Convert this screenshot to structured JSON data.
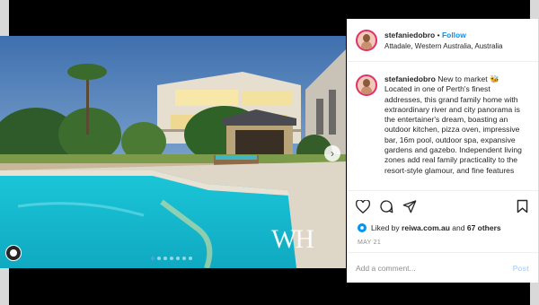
{
  "header": {
    "username": "stefaniedobro",
    "separator": "•",
    "follow_label": "Follow",
    "location": "Attadale, Western Australia, Australia"
  },
  "caption": {
    "username": "stefaniedobro",
    "text": "New to market 🐝 Located in one of Perth's finest addresses, this grand family home with extraordinary river and city panorama is the entertainer's dream, boasting an outdoor kitchen, pizza oven, impressive bar, 16m pool, outdoor spa, expansive gardens and gazebo. Independent living zones add real family practicality to the resort-style glamour, and fine features"
  },
  "actions": {
    "like_icon": "heart-icon",
    "comment_icon": "comment-icon",
    "share_icon": "share-icon",
    "save_icon": "bookmark-icon"
  },
  "likes": {
    "prefix": "Liked by",
    "user": "reiwa.com.au",
    "connector": "and",
    "others": "67 others"
  },
  "date": "MAY 21",
  "comment": {
    "placeholder": "Add a comment...",
    "post_label": "Post"
  },
  "photo": {
    "watermark": "WH",
    "carousel_count": 7,
    "carousel_active": 1
  },
  "colors": {
    "follow": "#0095f6",
    "carousel_active": "#4aa3df",
    "post_disabled": "#b3dbff"
  }
}
